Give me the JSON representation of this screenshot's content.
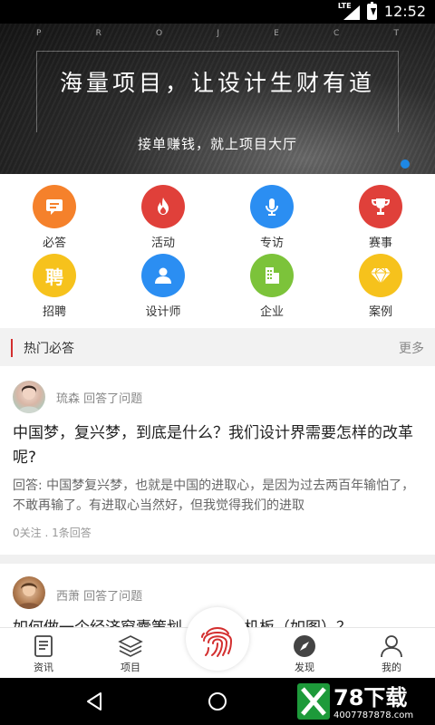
{
  "status_bar": {
    "network": "LTE",
    "time": "12:52"
  },
  "banner": {
    "top_letters": [
      "P",
      "R",
      "O",
      "J",
      "E",
      "C",
      "T"
    ],
    "headline": "海量项目，让设计生财有道",
    "subline": "接单赚钱，就上项目大厅"
  },
  "categories": [
    {
      "label": "必答",
      "color": "#f5812b",
      "icon": "chat-icon"
    },
    {
      "label": "活动",
      "color": "#e0403a",
      "icon": "flame-icon"
    },
    {
      "label": "专访",
      "color": "#2b8ef2",
      "icon": "microphone-icon"
    },
    {
      "label": "赛事",
      "color": "#e0403a",
      "icon": "trophy-icon"
    },
    {
      "label": "招聘",
      "color": "#f6c21c",
      "icon": "recruit-icon",
      "glyph": "聘"
    },
    {
      "label": "设计师",
      "color": "#2b8ef2",
      "icon": "person-icon"
    },
    {
      "label": "企业",
      "color": "#7cc33a",
      "icon": "building-icon"
    },
    {
      "label": "案例",
      "color": "#f6c21c",
      "icon": "diamond-icon"
    }
  ],
  "section": {
    "title": "热门必答",
    "more": "更多"
  },
  "posts": [
    {
      "user": "琉森",
      "action": "回答了问题",
      "question": "中国梦，复兴梦，到底是什么？我们设计界需要怎样的改革呢?",
      "answer": "回答: 中国梦复兴梦，也就是中国的进取心，是因为过去两百年输怕了，不敢再输了。有进取心当然好，但我觉得我们的进取",
      "stats": "0关注 . 1条回答"
    },
    {
      "user": "西萧",
      "action": "回答了问题",
      "question": "如何做一个经济窗囊策划，可造本机板（如图）？"
    }
  ],
  "tabs": [
    {
      "label": "资讯",
      "icon": "news-icon"
    },
    {
      "label": "项目",
      "icon": "layers-icon"
    },
    {
      "label": "发现",
      "icon": "compass-icon"
    },
    {
      "label": "我的",
      "icon": "profile-icon"
    }
  ],
  "center_button": {
    "icon": "fingerprint-icon"
  },
  "watermark": {
    "brand": "78下载",
    "url": "4007787878.com"
  }
}
